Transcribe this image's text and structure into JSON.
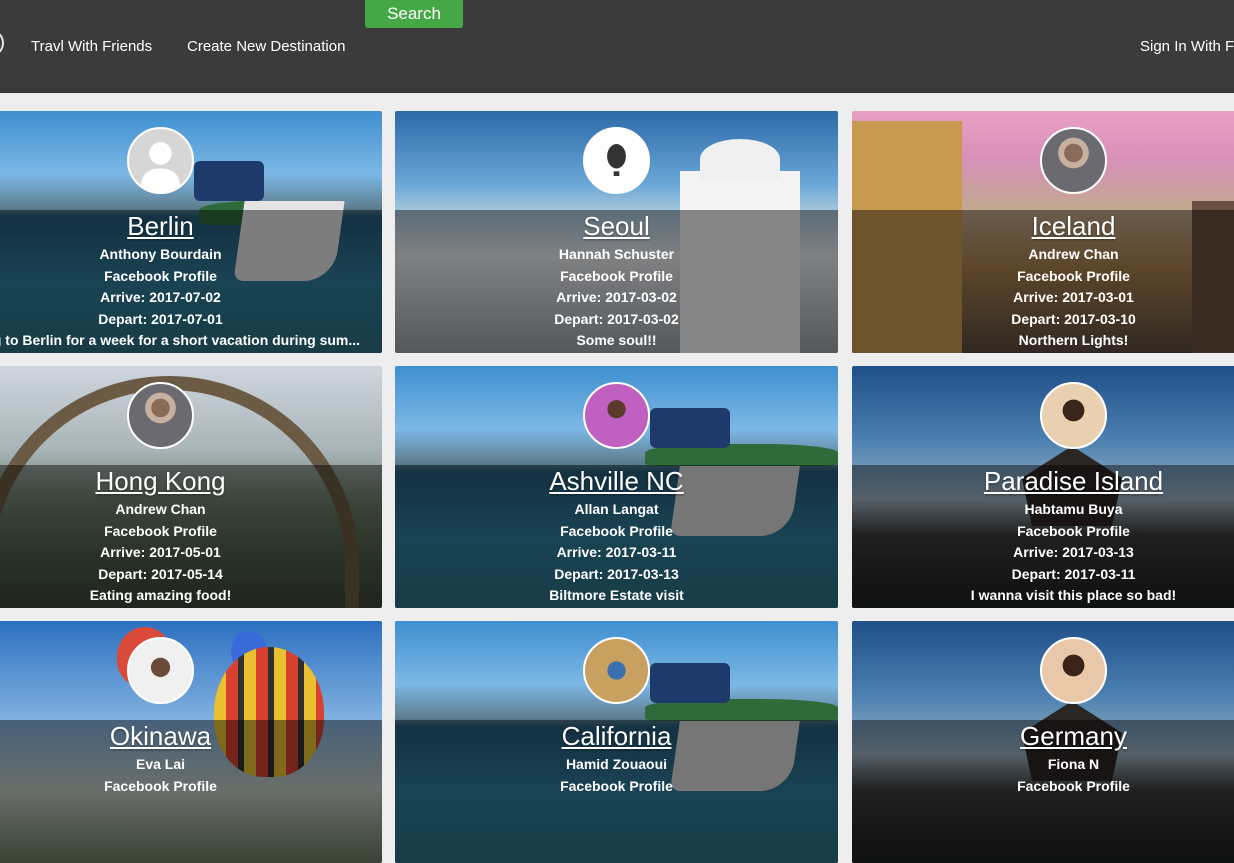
{
  "nav": {
    "search_label": "Search",
    "links": [
      "Travl With Friends",
      "Create New Destination"
    ],
    "signin_label": "Sign In With F"
  },
  "cards": [
    {
      "city": "Berlin",
      "name": "Anthony Bourdain",
      "profile": "Facebook Profile",
      "arrive": "Arrive: 2017-07-02",
      "depart": "Depart: 2017-07-01",
      "note": "Going to Berlin for a week for a short vacation during sum..."
    },
    {
      "city": "Seoul",
      "name": "Hannah Schuster",
      "profile": "Facebook Profile",
      "arrive": "Arrive: 2017-03-02",
      "depart": "Depart: 2017-03-02",
      "note": "Some soul!!"
    },
    {
      "city": "Iceland",
      "name": "Andrew Chan",
      "profile": "Facebook Profile",
      "arrive": "Arrive: 2017-03-01",
      "depart": "Depart: 2017-03-10",
      "note": "Northern Lights!"
    },
    {
      "city": "Hong Kong",
      "name": "Andrew Chan",
      "profile": "Facebook Profile",
      "arrive": "Arrive: 2017-05-01",
      "depart": "Depart: 2017-05-14",
      "note": "Eating amazing food!"
    },
    {
      "city": "Ashville NC",
      "name": "Allan Langat",
      "profile": "Facebook Profile",
      "arrive": "Arrive: 2017-03-11",
      "depart": "Depart: 2017-03-13",
      "note": "Biltmore Estate visit"
    },
    {
      "city": "Paradise Island",
      "name": "Habtamu Buya",
      "profile": "Facebook Profile",
      "arrive": "Arrive: 2017-03-13",
      "depart": "Depart: 2017-03-11",
      "note": "I wanna visit this place so bad!"
    },
    {
      "city": "Okinawa",
      "name": "Eva Lai",
      "profile": "Facebook Profile"
    },
    {
      "city": "California",
      "name": "Hamid Zouaoui",
      "profile": "Facebook Profile"
    },
    {
      "city": "Germany",
      "name": "Fiona N",
      "profile": "Facebook Profile"
    }
  ]
}
